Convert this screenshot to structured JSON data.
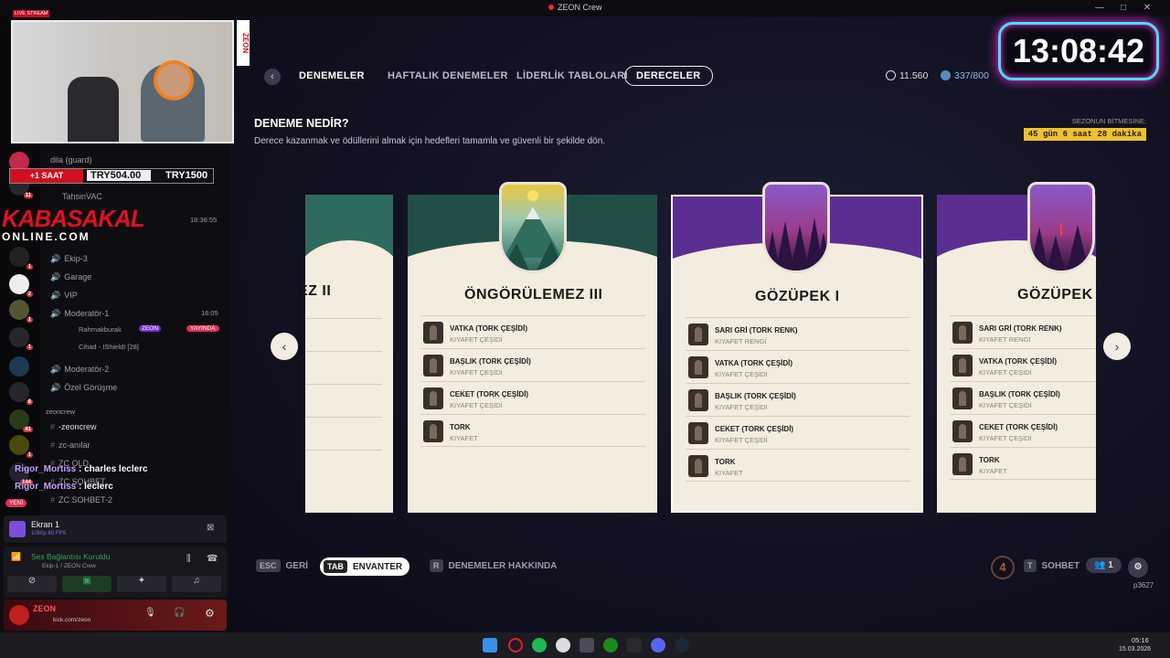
{
  "window": {
    "title": "ZEON Crew",
    "controls": [
      "—",
      "□",
      "✕"
    ]
  },
  "nav": {
    "back": "‹",
    "tabs": [
      "DENEMELER",
      "HAFTALIK DENEMELER",
      "LİDERLİK TABLOLARI",
      "DERECELER"
    ],
    "currency1": "11.560",
    "currency2": "337/800"
  },
  "header": {
    "title": "DENEME NEDİR?",
    "subtitle": "Derece kazanmak ve ödüllerini almak için hedefleri tamamla ve güvenli bir şekilde dön.",
    "season_label": "SEZONUN BİTMESİNE:",
    "season_value": "45 gün 6 saat 28 dakika"
  },
  "cards": [
    {
      "title": "EZ II",
      "items": []
    },
    {
      "title": "ÖNGÖRÜLEMEZ III",
      "items": [
        {
          "n": "VATKA (TORK ÇEŞİDİ)",
          "s": "KIYAFET ÇEŞİDİ"
        },
        {
          "n": "BAŞLIK (TORK ÇEŞİDİ)",
          "s": "KIYAFET ÇEŞİDİ"
        },
        {
          "n": "CEKET (TORK ÇEŞİDİ)",
          "s": "KIYAFET ÇEŞİDİ"
        },
        {
          "n": "TORK",
          "s": "KIYAFET"
        }
      ]
    },
    {
      "title": "GÖZÜPEK I",
      "items": [
        {
          "n": "SARI GRİ (TORK RENK)",
          "s": "KIYAFET RENGİ"
        },
        {
          "n": "VATKA (TORK ÇEŞİDİ)",
          "s": "KIYAFET ÇEŞİDİ"
        },
        {
          "n": "BAŞLIK (TORK ÇEŞİDİ)",
          "s": "KIYAFET ÇEŞİDİ"
        },
        {
          "n": "CEKET (TORK ÇEŞİDİ)",
          "s": "KIYAFET ÇEŞİDİ"
        },
        {
          "n": "TORK",
          "s": "KIYAFET"
        }
      ]
    },
    {
      "title": "GÖZÜPEK",
      "items": [
        {
          "n": "SARI GRİ (TORK RENK)",
          "s": "KIYAFET RENGİ"
        },
        {
          "n": "VATKA (TORK ÇEŞİDİ)",
          "s": "KIYAFET ÇEŞİDİ"
        },
        {
          "n": "BAŞLIK (TORK ÇEŞİDİ)",
          "s": "KIYAFET ÇEŞİDİ"
        },
        {
          "n": "CEKET (TORK ÇEŞİDİ)",
          "s": "KIYAFET ÇEŞİDİ"
        },
        {
          "n": "TORK",
          "s": "KIYAFET"
        }
      ]
    }
  ],
  "bottom": {
    "esc": "ESC",
    "back": "GERİ",
    "tab": "TAB",
    "inventory": "ENVANTER",
    "r": "R",
    "about": "DENEMELER HAKKINDA",
    "t": "T",
    "chat": "SOHBET",
    "party": "1",
    "level": "4",
    "user": "p3627"
  },
  "overlay": {
    "clock": "13:08:42",
    "live": "LIVE STREAM",
    "brand": "ZEON",
    "time_badge": "+1 SAAT",
    "price1": "TRY504.00",
    "price2": "TRY1500",
    "logo_line1": "KABASAKAL",
    "logo_line2": "ONLINE.COM"
  },
  "discord": {
    "channels": [
      "dila (guard)",
      "TahsinVAC",
      "Ekip-3",
      "Garage",
      "VIP",
      "Moderatör-1",
      "Rahmakburak",
      "Cihad - IShieldI [28]",
      "Moderatör-2",
      "Özel Görüşme",
      "zeoncrew",
      "-zeoncrew",
      "zc-anılar",
      "ZC OLD",
      "ZC SOHBET",
      "ZC SOHBET-2"
    ],
    "time1": "18:36:55",
    "time2": "16:05",
    "live_tag": "YAYINDA",
    "zeon_tag": "ZEON",
    "chat": [
      {
        "u": "Rigor_Mortiss",
        "m": "charles leclerc"
      },
      {
        "u": "Rigor_Mortiss",
        "m": "leclerc"
      }
    ],
    "new": "YENİ",
    "screen": "Ekran 1",
    "screen_sub": "1080p 60 FPS",
    "voice": "Ses Bağlantısı Kuruldu",
    "voice_sub": "Ekip-1 / ZEON Crew",
    "user": "ZEON",
    "user_sub": "kick.com/zeon"
  },
  "taskbar": {
    "time": "05:16",
    "date": "15.03.2026"
  }
}
